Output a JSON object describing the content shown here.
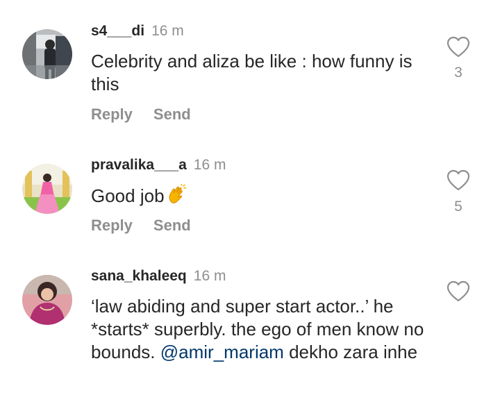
{
  "comments": [
    {
      "username": "s4___di",
      "time": "16 m",
      "text": "Celebrity and aliza be like : how funny is this",
      "likes": "3",
      "actions": {
        "reply": "Reply",
        "send": "Send"
      }
    },
    {
      "username": "pravalika___a",
      "time": "16 m",
      "text": "Good job",
      "emoji": "clapping-hands",
      "likes": "5",
      "actions": {
        "reply": "Reply",
        "send": "Send"
      }
    },
    {
      "username": "sana_khaleeq",
      "time": "16 m",
      "text_before_mention": "‘law abiding and super start actor..’ he *starts* superbly. the ego of men know no bounds.",
      "mention": "@amir_mariam",
      "text_after_mention": "dekho zara inhe"
    }
  ],
  "icons": {
    "like": "heart-outline-icon"
  },
  "colors": {
    "text": "#262626",
    "secondary": "#8e8e8e",
    "mention": "#00376b"
  }
}
